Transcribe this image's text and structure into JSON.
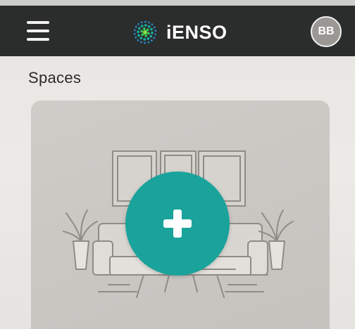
{
  "app": {
    "brand_name": "iENSO",
    "logo_icon": "green-dot-burst-icon",
    "accent_color": "#19a39b",
    "header_color": "#2a2d2b"
  },
  "header": {
    "menu_icon": "hamburger-menu-icon",
    "avatar_initials": "BB"
  },
  "main": {
    "title": "Spaces",
    "add_space_icon": "plus-icon"
  }
}
